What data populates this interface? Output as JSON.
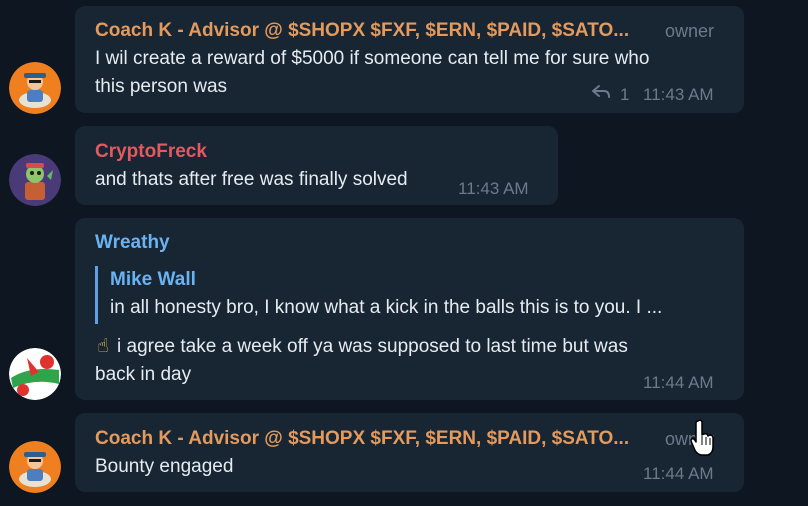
{
  "messages": [
    {
      "sender": "Coach K - Advisor @ $SHOPX $FXF, $ERN, $PAID, $SATO...",
      "role": "owner",
      "text": "I wil create a reward of $5000 if someone can tell me for sure who\nthis person was",
      "reply_count": "1",
      "time": "11:43 AM"
    },
    {
      "sender": "CryptoFreck",
      "text": "and thats after free was finally solved",
      "time": "11:43 AM"
    },
    {
      "sender": "Wreathy",
      "quote_name": "Mike Wall",
      "quote_text": "in all honesty bro, I know what a kick in the balls this is to you.  I ...",
      "emoji": "☝",
      "text": "i agree take a week off ya was supposed to last time but was\nback in day",
      "time": "11:44 AM"
    },
    {
      "sender": "Coach K - Advisor @ $SHOPX $FXF, $ERN, $PAID, $SATO...",
      "role": "owner",
      "text": "Bounty engaged",
      "time": "11:44 AM"
    }
  ],
  "colors": {
    "background": "#0e1621",
    "bubble": "#182533",
    "coach_name": "#e39a5c",
    "freck_name": "#e4595f",
    "wreathy_name": "#6ab3f3",
    "muted": "#6b7b8c"
  },
  "icons": {
    "reply": "reply-arrow-icon",
    "cursor": "hand-pointer-cursor-icon"
  }
}
